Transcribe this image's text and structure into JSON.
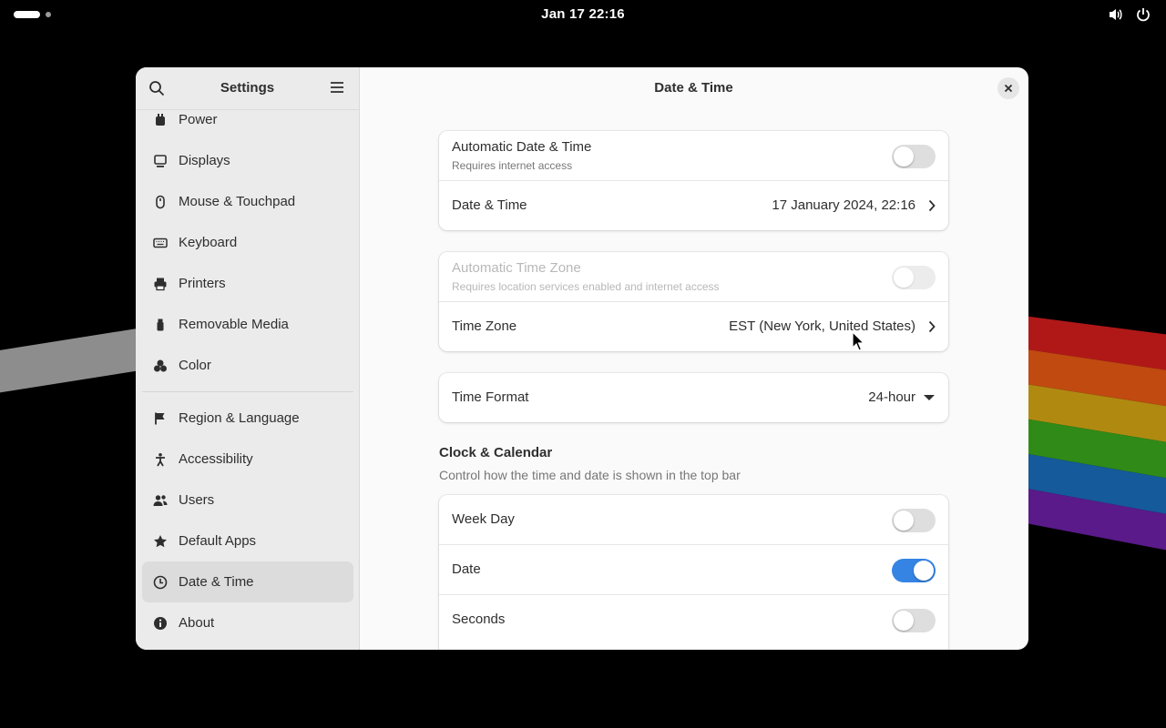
{
  "topbar": {
    "clock": "Jan 17  22:16",
    "icons": [
      "volume-icon",
      "power-icon"
    ]
  },
  "sidebar": {
    "title": "Settings",
    "items": [
      {
        "label": "Power",
        "icon": "power-plug-icon"
      },
      {
        "label": "Displays",
        "icon": "display-icon"
      },
      {
        "label": "Mouse & Touchpad",
        "icon": "mouse-icon"
      },
      {
        "label": "Keyboard",
        "icon": "keyboard-icon"
      },
      {
        "label": "Printers",
        "icon": "printer-icon"
      },
      {
        "label": "Removable Media",
        "icon": "usb-icon"
      },
      {
        "label": "Color",
        "icon": "color-icon"
      },
      {
        "label": "Region & Language",
        "icon": "flag-icon"
      },
      {
        "label": "Accessibility",
        "icon": "accessibility-icon"
      },
      {
        "label": "Users",
        "icon": "users-icon"
      },
      {
        "label": "Default Apps",
        "icon": "star-icon"
      },
      {
        "label": "Date & Time",
        "icon": "clock-icon",
        "active": true
      },
      {
        "label": "About",
        "icon": "info-icon"
      }
    ]
  },
  "content": {
    "title": "Date & Time",
    "auto_datetime": {
      "label": "Automatic Date & Time",
      "sub": "Requires internet access",
      "enabled": false
    },
    "datetime": {
      "label": "Date & Time",
      "value": "17 January 2024, 22:16"
    },
    "auto_timezone": {
      "label": "Automatic Time Zone",
      "sub": "Requires location services enabled and internet access",
      "enabled": false,
      "disabled": true
    },
    "timezone": {
      "label": "Time Zone",
      "value": "EST (New York, United States)"
    },
    "time_format": {
      "label": "Time Format",
      "value": "24-hour"
    },
    "clock_section": {
      "title": "Clock & Calendar",
      "desc": "Control how the time and date is shown in the top bar",
      "week_day": {
        "label": "Week Day",
        "enabled": false
      },
      "date": {
        "label": "Date",
        "enabled": true
      },
      "seconds": {
        "label": "Seconds",
        "enabled": false
      }
    }
  },
  "colors": {
    "accent": "#3584e4"
  }
}
